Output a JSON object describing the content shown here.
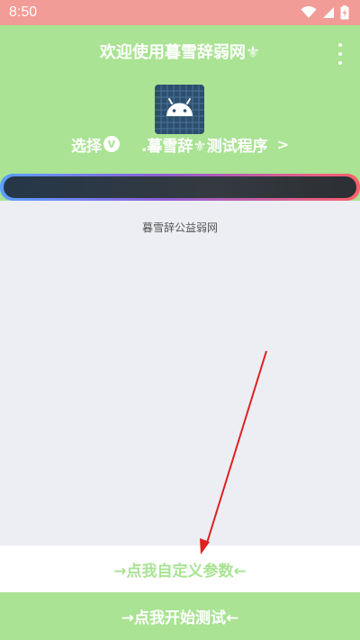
{
  "status_bar": {
    "time": "8:50",
    "icons": [
      "wifi-icon",
      "signal-icon",
      "battery-charging-icon"
    ]
  },
  "header": {
    "title": "欢迎使用暮雪辞弱网⚜",
    "menu_icon": "more-vert-icon",
    "app_icon": "android-app-icon",
    "select_prefix": "选择",
    "select_badge": "V",
    "select_app": ".暮雪辞⚜测试程序",
    "select_chevron": ">"
  },
  "progress": {
    "fill_fraction": 1.0
  },
  "main": {
    "org_label": "暮雪辞公益弱网"
  },
  "buttons": {
    "custom_params": "→点我自定义参数←",
    "start_test": "→点我开始测试←"
  },
  "colors": {
    "status_bar": "#f19c96",
    "header": "#a9e393",
    "accent": "#a9e393",
    "background": "#eceef3",
    "annotation_arrow": "#e02020"
  }
}
